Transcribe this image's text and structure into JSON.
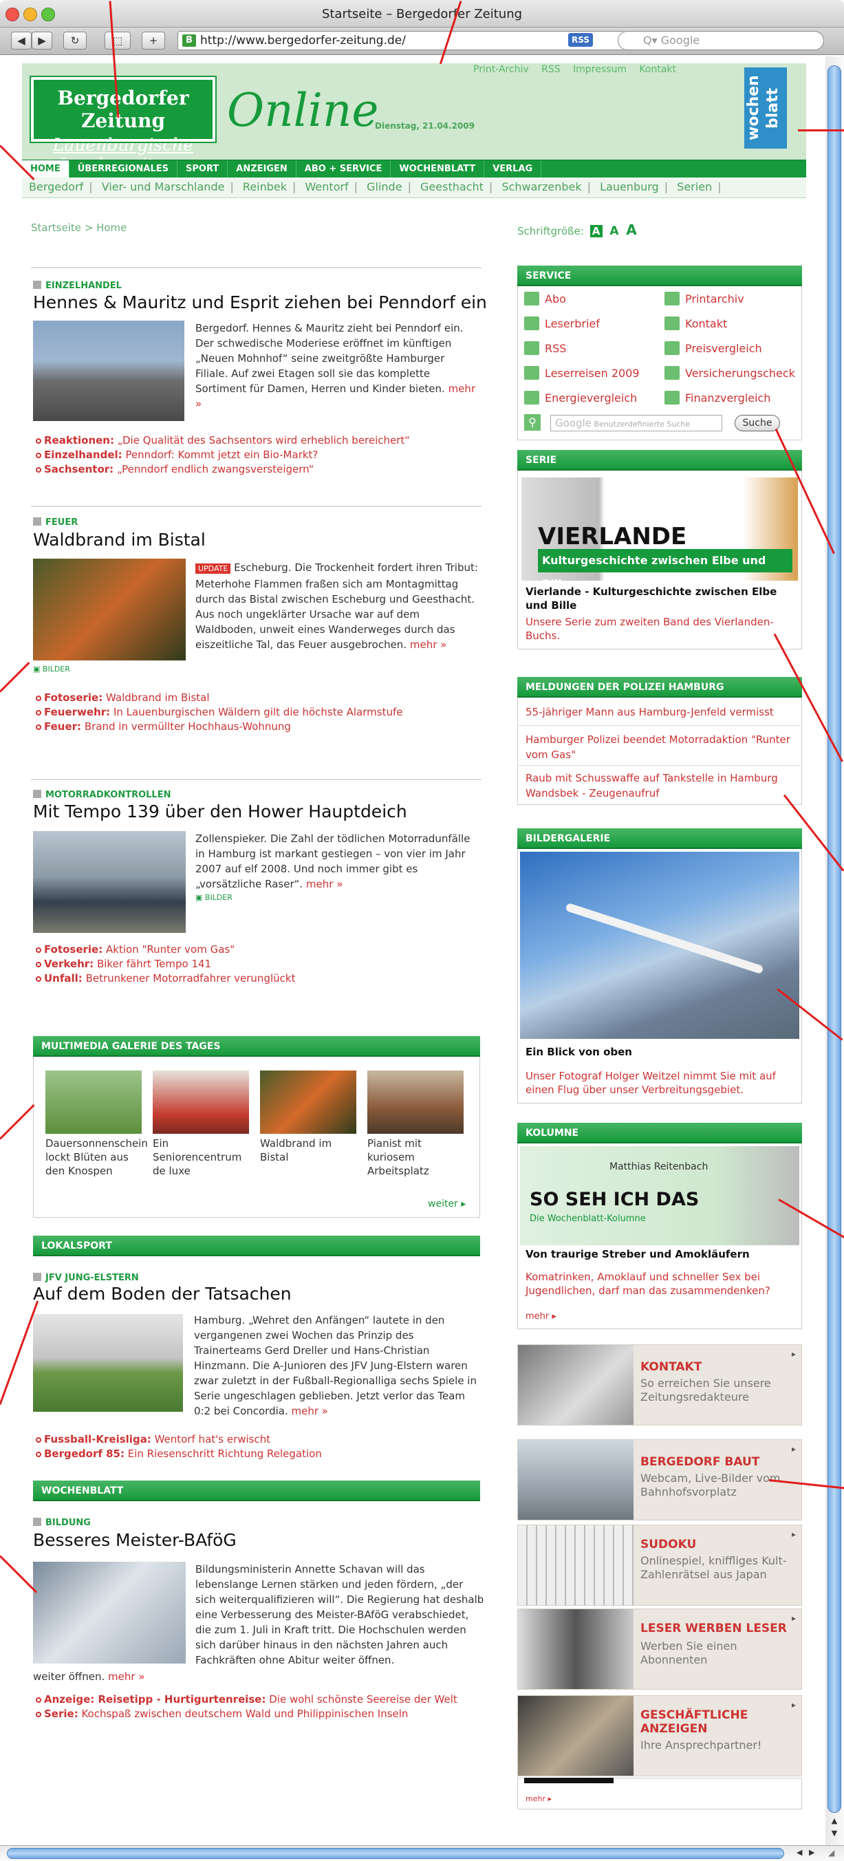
{
  "window": {
    "title": "Startseite – Bergedorfer Zeitung"
  },
  "toolbar": {
    "url": "http://www.bergedorfer-zeitung.de/",
    "rss_label": "RSS",
    "search_placeholder": "Q▾ Google",
    "favicon_letter": "B"
  },
  "header": {
    "logo_line1": "Bergedorfer Zeitung",
    "logo_line2": "Lauenburgische Landeszeitung",
    "online": "Online",
    "date": "Dienstag, 21.04.2009",
    "toplinks": [
      "Print-Archiv",
      "RSS",
      "Impressum",
      "Kontakt"
    ],
    "wochenblatt": "wochen blatt"
  },
  "nav": [
    "HOME",
    "ÜBERREGIONALES",
    "SPORT",
    "ANZEIGEN",
    "ABO + SERVICE",
    "WOCHENBLATT",
    "VERLAG"
  ],
  "subnav": [
    "Bergedorf",
    "Vier- und Marschlande",
    "Reinbek",
    "Wentorf",
    "Glinde",
    "Geesthacht",
    "Schwarzenbek",
    "Lauenburg",
    "Serien"
  ],
  "breadcrumb": "Startseite > Home",
  "fontsize": {
    "label": "Schriftgröße:",
    "a": "A"
  },
  "articles": [
    {
      "kicker": "EINZELHANDEL",
      "headline": "Hennes & Mauritz und Esprit ziehen bei Penndorf ein",
      "teaser": "Bergedorf. Hennes & Mauritz zieht bei Penndorf ein. Der schwedische Moderiese eröffnet im künftigen „Neuen Mohnhof“ seine zweitgrößte Hamburger Filiale. Auf zwei Etagen soll sie das komplette Sortiment für Damen, Herren und Kinder bieten.",
      "more": "mehr »",
      "related": [
        {
          "label": "Reaktionen:",
          "text": "„Die Qualität des Sachsentors wird erheblich bereichert“"
        },
        {
          "label": "Einzelhandel:",
          "text": "Penndorf: Kommt jetzt ein Bio-Markt?"
        },
        {
          "label": "Sachsentor:",
          "text": "„Penndorf endlich zwangsversteigern“"
        }
      ]
    },
    {
      "kicker": "FEUER",
      "headline": "Waldbrand im Bistal",
      "badge": "UPDATE",
      "teaser": "Escheburg. Die Trockenheit fordert ihren Tribut: Meterhohe Flammen fraßen sich am Montagmittag durch das Bistal zwischen Escheburg und Geesthacht. Aus noch ungeklärter Ursache war auf dem Waldboden, unweit eines Wanderweges durch das eiszeitliche Tal, das Feuer ausgebrochen.",
      "more": "mehr »",
      "bilder": "BILDER",
      "related": [
        {
          "label": "Fotoserie:",
          "text": "Waldbrand im Bistal"
        },
        {
          "label": "Feuerwehr:",
          "text": "In Lauenburgischen Wäldern gilt die höchste Alarmstufe"
        },
        {
          "label": "Feuer:",
          "text": "Brand in vermüllter Hochhaus-Wohnung"
        }
      ]
    },
    {
      "kicker": "MOTORRADKONTROLLEN",
      "headline": "Mit Tempo 139 über den Hower Hauptdeich",
      "teaser": "Zollenspieker. Die Zahl der tödlichen Motorradunfälle in Hamburg ist markant gestiegen – von vier im Jahr 2007 auf elf 2008. Und noch immer gibt es „vorsätzliche Raser“.",
      "more": "mehr »",
      "bilder": "BILDER",
      "related": [
        {
          "label": "Fotoserie:",
          "text": "Aktion \"Runter vom Gas\""
        },
        {
          "label": "Verkehr:",
          "text": "Biker fährt Tempo 141"
        },
        {
          "label": "Unfall:",
          "text": "Betrunkener Motorradfahrer verunglückt"
        }
      ]
    }
  ],
  "multimedia": {
    "title": "MULTIMEDIA GALERIE DES TAGES",
    "items": [
      "Dauersonnenschein lockt Blüten aus den Knospen",
      "Ein Seniorencentrum de luxe",
      "Waldbrand im Bistal",
      "Pianist mit kuriosem Arbeitsplatz"
    ],
    "more": "weiter ▸"
  },
  "lokalsport": {
    "title": "LOKALSPORT",
    "kicker": "JFV JUNG-ELSTERN",
    "headline": "Auf dem Boden der Tatsachen",
    "teaser": "Hamburg. „Wehret den Anfängen“ lautete in den vergangenen zwei Wochen das Prinzip des Trainerteams Gerd Dreller und Hans-Christian Hinzmann. Die A-Junioren des JFV Jung-Elstern waren zwar zuletzt in der Fußball-Regionalliga sechs Spiele in Serie ungeschlagen geblieben. Jetzt verlor das Team 0:2 bei Concordia.",
    "more": "mehr »",
    "related": [
      {
        "label": "Fussball-Kreisliga:",
        "text": "Wentorf hat's erwischt"
      },
      {
        "label": "Bergedorf 85:",
        "text": "Ein Riesenschritt Richtung Relegation"
      }
    ]
  },
  "wochenblatt": {
    "title": "WOCHENBLATT",
    "kicker": "BILDUNG",
    "headline": "Besseres Meister-BAföG",
    "teaser": "Bildungsministerin Annette Schavan will das lebenslange Lernen stärken und jeden fördern, „der sich weiterqualifizieren will“. Die Regierung hat deshalb eine Verbesserung des Meister-BAföG verabschiedet, die zum 1. Juli in Kraft tritt. Die Hochschulen werden sich darüber hinaus in den nächsten Jahren auch Fachkräften ohne Abitur weiter öffnen.",
    "more": "mehr »",
    "related": [
      {
        "label": "Anzeige: Reisetipp - Hurtigurtenreise:",
        "text": "Die wohl schönste Seereise der Welt"
      },
      {
        "label": "Serie:",
        "text": "Kochspaß zwischen deutschem Wald und Philippinischen Inseln"
      }
    ]
  },
  "service": {
    "title": "SERVICE",
    "left": [
      "Abo",
      "Leserbrief",
      "RSS",
      "Leserreisen 2009",
      "Energievergleich"
    ],
    "right": [
      "Printarchiv",
      "Kontakt",
      "Preisvergleich",
      "Versicherungscheck",
      "Finanzvergleich"
    ],
    "search_placeholder": "Benutzerdefinierte Suche",
    "google": "Google",
    "search_button": "Suche"
  },
  "serie": {
    "title": "SERIE",
    "img_title": "VIERLANDE",
    "img_sub": "Kulturgeschichte zwischen Elbe und Bille",
    "heading": "Vierlande - Kulturgeschichte zwischen Elbe und Bille",
    "text": "Unsere Serie zum zweiten Band des Vierlanden-Buchs."
  },
  "polizei": {
    "title": "MELDUNGEN DER POLIZEI HAMBURG",
    "items": [
      "55-jähriger Mann aus Hamburg-Jenfeld vermisst",
      "Hamburger Polizei beendet Motorradaktion \"Runter vom Gas\"",
      "Raub mit Schusswaffe auf Tankstelle in Hamburg Wandsbek - Zeugenaufruf"
    ]
  },
  "galerie": {
    "title": "BILDERGALERIE",
    "heading": "Ein Blick von oben",
    "text": "Unser Fotograf Holger Weitzel nimmt Sie mit auf einen Flug über unser Verbreitungsgebiet."
  },
  "kolumne": {
    "title": "KOLUMNE",
    "author": "Matthias Reitenbach",
    "img_title": "SO SEH ICH DAS",
    "img_sub": "Die Wochenblatt-Kolumne",
    "heading": "Von traurige Streber und Amokläufern",
    "text": "Komatrinken, Amoklauf und schneller Sex bei Jugendlichen, darf man das zusammendenken?",
    "more": "mehr ▸"
  },
  "promos": [
    {
      "title": "KONTAKT",
      "desc": "So erreichen Sie unsere Zeitungsredakteure"
    },
    {
      "title": "BERGEDORF BAUT",
      "desc": "Webcam, Live-Bilder vom Bahnhofsvorplatz"
    },
    {
      "title": "SUDOKU",
      "desc": "Onlinespiel, kniffliges Kult-Zahlenrätsel aus Japan"
    },
    {
      "title": "LESER WERBEN LESER",
      "desc": "Werben Sie einen Abonnenten"
    },
    {
      "title": "GESCHÄFTLICHE ANZEIGEN",
      "desc": "Ihre Ansprechpartner!"
    }
  ],
  "sidebar_more": "mehr ▸",
  "colors": {
    "brand_green": "#169a3c",
    "link_red": "#cc3333",
    "annotation_red": "#e01e1e"
  }
}
